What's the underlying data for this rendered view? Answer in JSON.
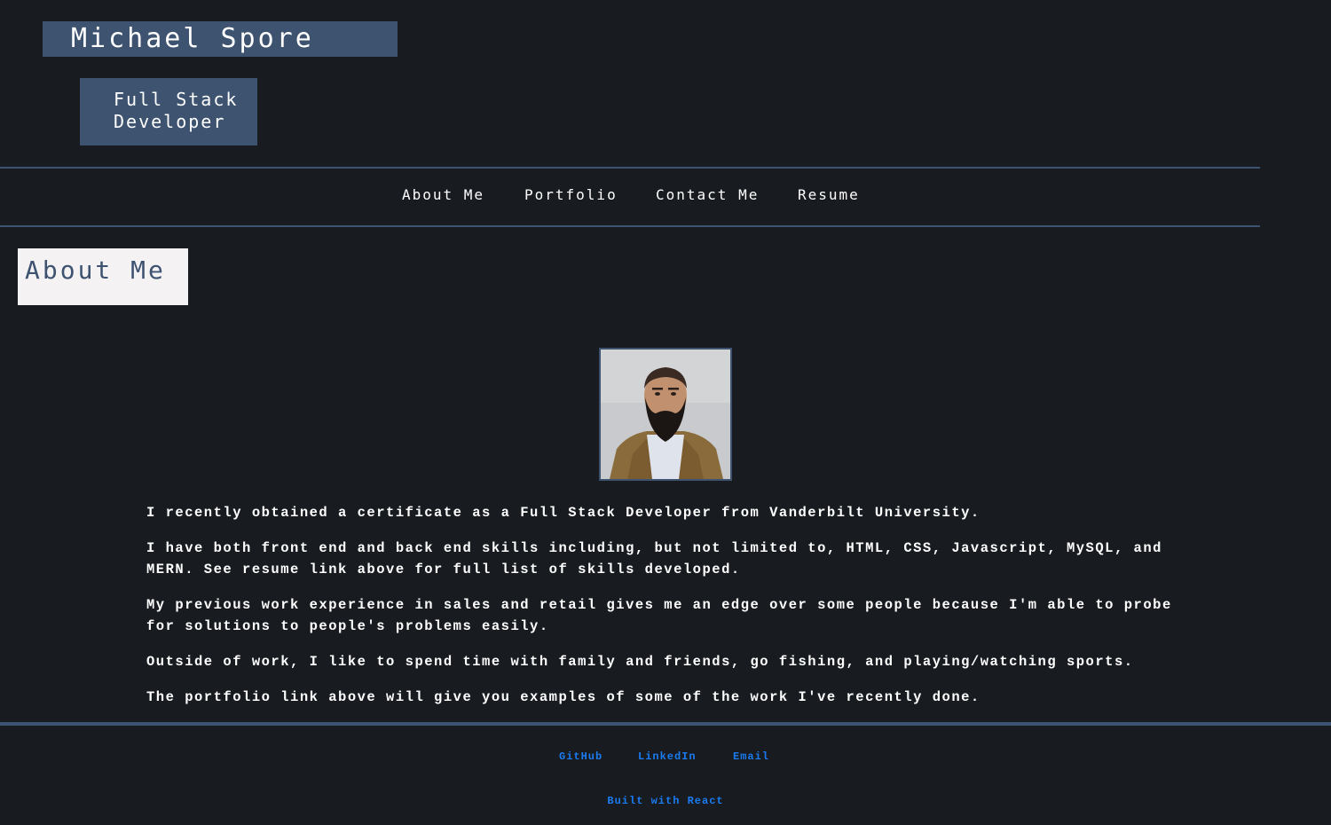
{
  "header": {
    "name": "Michael Spore",
    "role_line1": "Full Stack",
    "role_line2": "Developer"
  },
  "nav": {
    "items": [
      "About Me",
      "Portfolio",
      "Contact Me",
      "Resume"
    ]
  },
  "about": {
    "title": "About Me",
    "paragraphs": [
      "I recently obtained a certificate as a Full Stack Developer from Vanderbilt University.",
      "I have both front end and back end skills including, but not limited to, HTML, CSS, Javascript, MySQL, and MERN. See resume link above for full list of skills developed.",
      "My previous work experience in sales and retail gives me an edge over some people because I'm able to probe for solutions to people's problems easily.",
      "Outside of work, I like to spend time with family and friends, go fishing, and playing/watching sports.",
      "The portfolio link above will give you examples of some of the work I've recently done."
    ]
  },
  "footer": {
    "links": [
      "GitHub",
      "LinkedIn",
      "Email"
    ],
    "built_with": "Built with React"
  },
  "colors": {
    "background": "#181b20",
    "accent": "#3d5370",
    "link": "#1a7cf2",
    "title_box": "#f4f2f3"
  }
}
